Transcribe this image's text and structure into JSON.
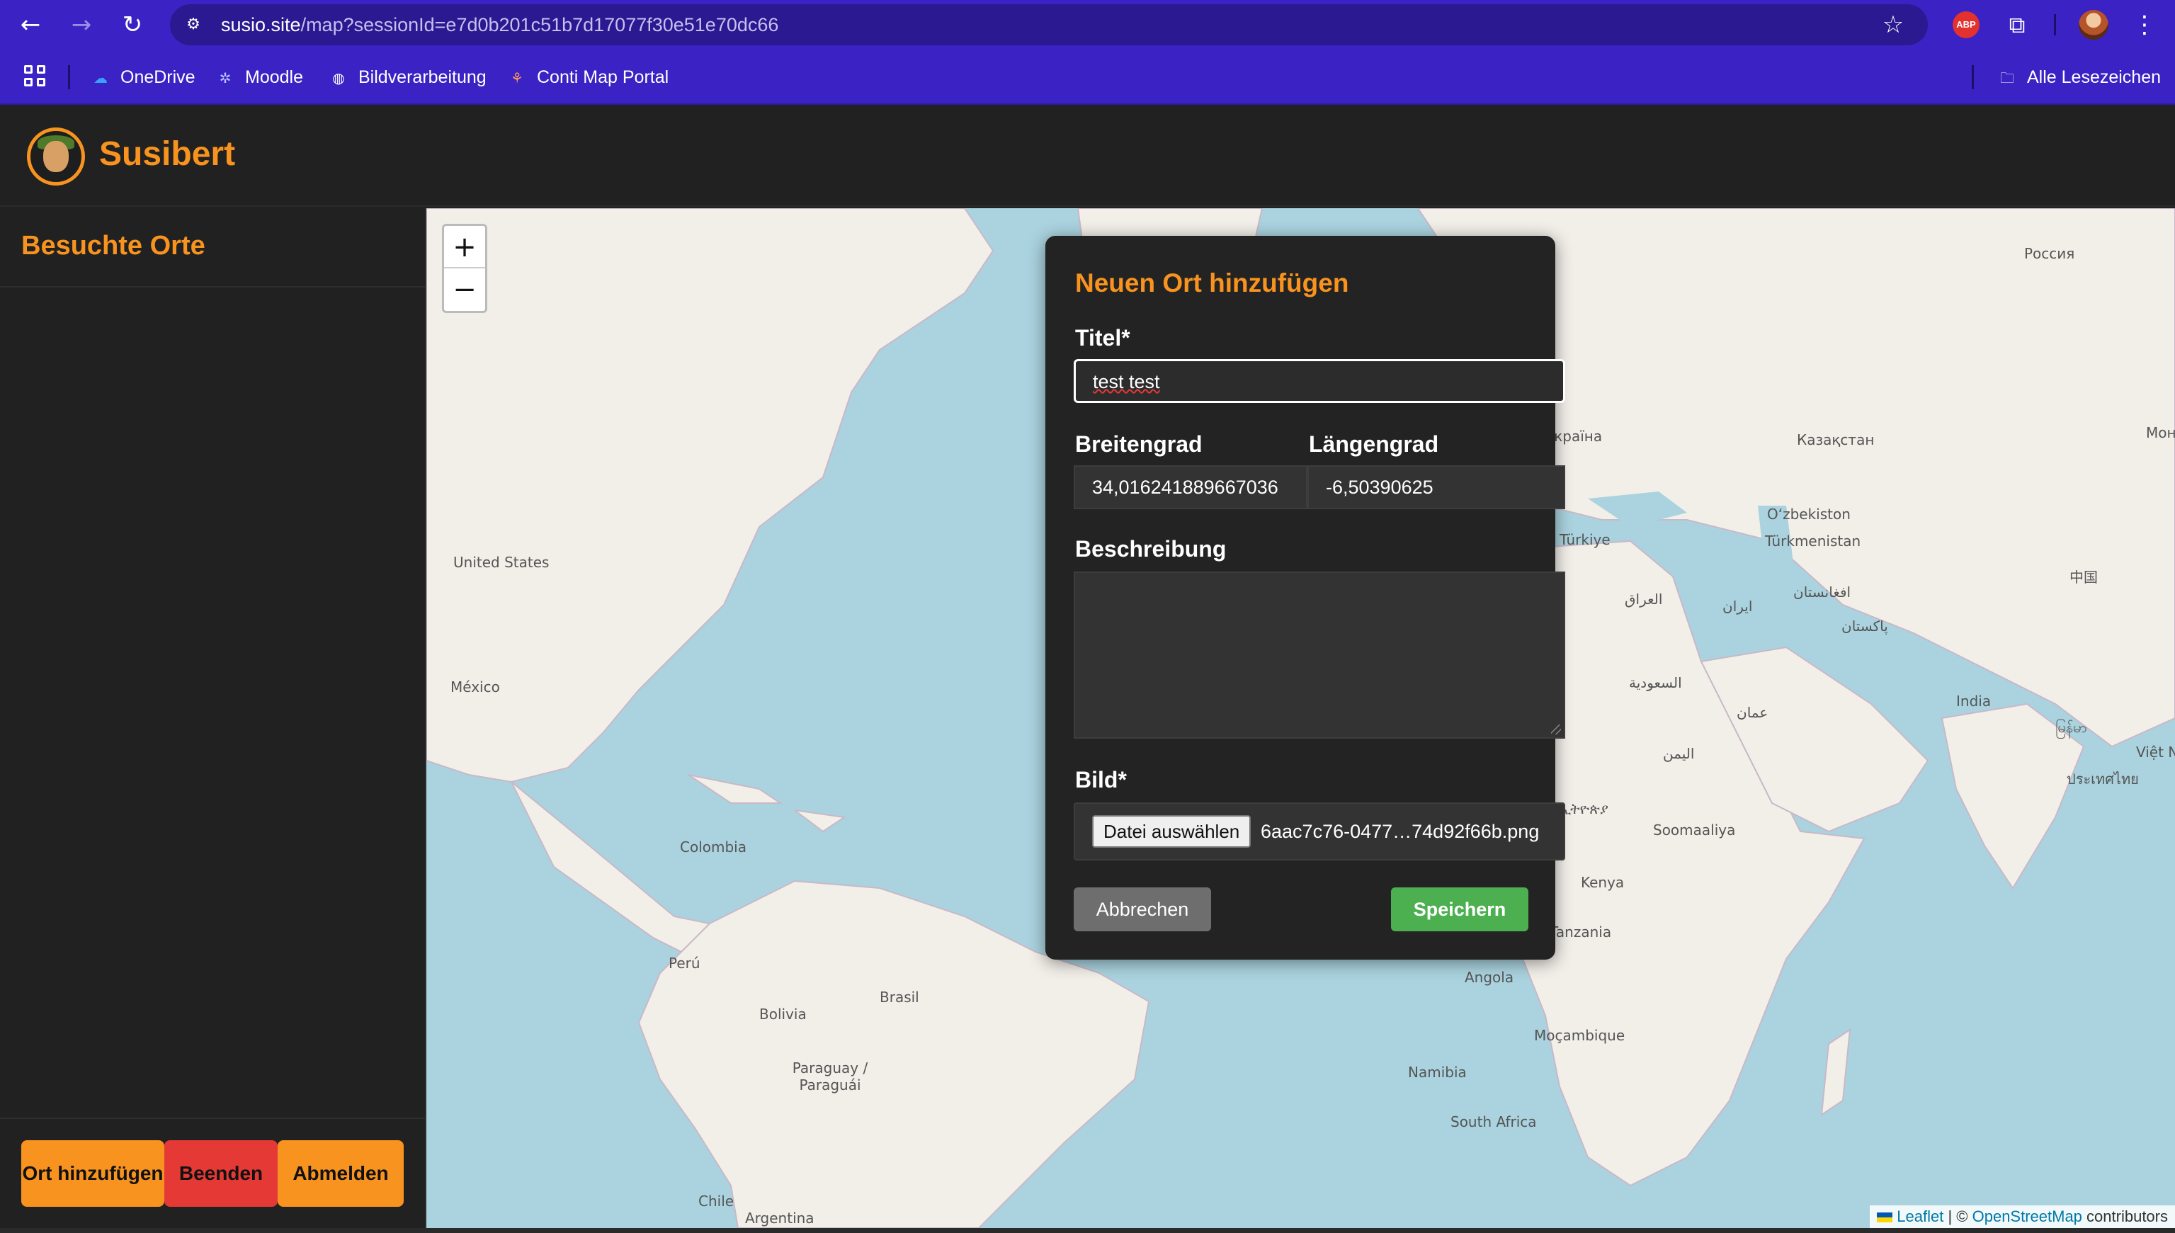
{
  "browser": {
    "url_host": "susio.site",
    "url_path": "/map?sessionId=e7d0b201c51b7d17077f30e51e70dc66",
    "extension_badge": "ABP",
    "icons": [
      "back-arrow-icon",
      "forward-arrow-icon",
      "reload-icon",
      "site-settings-icon",
      "star-icon",
      "extensions-icon",
      "kebab-menu-icon"
    ]
  },
  "bookmarks": {
    "items": [
      {
        "label": "OneDrive",
        "icon": "cloud-icon"
      },
      {
        "label": "Moodle",
        "icon": "moodle-icon"
      },
      {
        "label": "Bildverarbeitung",
        "icon": "globe-icon"
      },
      {
        "label": "Conti Map Portal",
        "icon": "map-portal-icon"
      }
    ],
    "all_bookmarks": "Alle Lesezeichen"
  },
  "app": {
    "title": "Susibert",
    "accent_color": "#f7931e"
  },
  "sidebar": {
    "title": "Besuchte Orte",
    "buttons": {
      "add": "Ort hinzufügen",
      "end": "Beenden",
      "logout": "Abmelden"
    }
  },
  "map": {
    "zoom_in": "+",
    "zoom_out": "−",
    "labels": {
      "russia": "Россия",
      "ukraina": "Україна",
      "kazakhstan": "Казақстан",
      "mongolia": "Монгол улс",
      "uzbekistan": "O‘zbekiston",
      "turkmenistan": "Türkmenistan",
      "turkiye": "Türkiye",
      "iraq": "العراق",
      "iran": "ایران",
      "afghanistan": "افغانستان",
      "pakistan": "پاکستان",
      "china": "中国",
      "india": "India",
      "saudi": "السعودية",
      "oman": "عمان",
      "yemen": "اليمن",
      "ethiopia": "ኢትዮጵያ",
      "somalia": "Soomaaliya",
      "kenya": "Kenya",
      "tanzania": "Tanzania",
      "angola": "Angola",
      "namibia": "Namibia",
      "mocambique": "Moçambique",
      "south_africa": "South Africa",
      "myanmar": "မြန်မာ",
      "thailand": "ประเทศไทย",
      "vietnam": "Việt N",
      "usa": "United States",
      "mexico": "México",
      "colombia": "Colombia",
      "peru": "Perú",
      "brasil": "Brasil",
      "bolivia": "Bolivia",
      "paraguay": "Paraguay / Paraguái",
      "chile": "Chile",
      "argentina": "Argentina"
    },
    "attribution": {
      "leaflet": "Leaflet",
      "separator": "| ©",
      "osm": "OpenStreetMap",
      "contributors": "contributors"
    }
  },
  "modal": {
    "title": "Neuen Ort hinzufügen",
    "title_label": "Titel*",
    "title_value": "test test",
    "lat_label": "Breitengrad",
    "lat_value": "34,016241889667036",
    "lng_label": "Längengrad",
    "lng_value": "-6,50390625",
    "desc_label": "Beschreibung",
    "desc_value": "",
    "image_label": "Bild*",
    "file_button": "Datei auswählen",
    "file_name": "6aac7c76-0477…74d92f66b.png",
    "cancel": "Abbrechen",
    "save": "Speichern",
    "save_color": "#4caf50",
    "cancel_color": "#6e6e6e"
  }
}
